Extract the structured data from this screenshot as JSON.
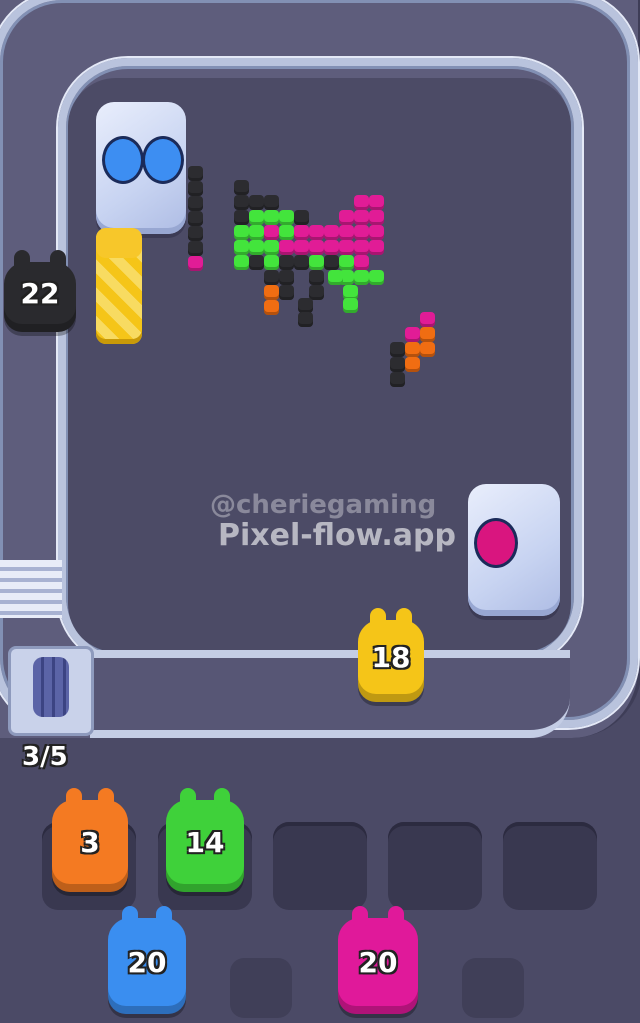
{
  "watermark": {
    "handle": "@cheriegaming",
    "site": "Pixel-flow.app"
  },
  "conveyor": {
    "queue_counter": "3/5"
  },
  "board": {
    "shooter_left_count": "22",
    "shooter_left_color": "#2a2a2e",
    "runner_on_belt_count": "18",
    "runner_on_belt_color": "#f5c518"
  },
  "slots": [
    {
      "count": "3",
      "color": "#f47a22",
      "filled": true
    },
    {
      "count": "14",
      "color": "#3fd13a",
      "filled": true
    },
    {
      "count": "",
      "color": "",
      "filled": false
    },
    {
      "count": "",
      "color": "",
      "filled": false
    },
    {
      "count": "",
      "color": "",
      "filled": false
    }
  ],
  "queue": [
    {
      "count": "20",
      "color": "#3a8ef0"
    },
    {
      "count": "20",
      "color": "#e0199a"
    }
  ],
  "colors": {
    "green": "#43e43c",
    "magenta": "#e11c96",
    "black": "#2c2c30",
    "orange": "#f06d12",
    "yellow": "#f7c72a",
    "blue_egg": "#3d8ef2",
    "pink_egg": "#d9157f"
  }
}
